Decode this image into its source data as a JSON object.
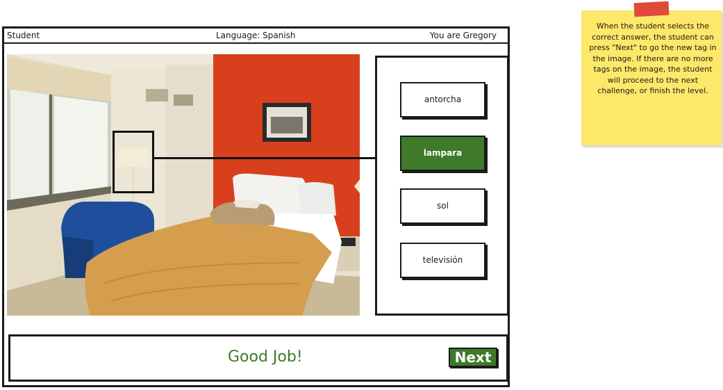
{
  "header": {
    "role": "Student",
    "language": "Language: Spanish",
    "user": "You are Gregory"
  },
  "options": [
    {
      "label": "antorcha",
      "selected": false
    },
    {
      "label": "lampara",
      "selected": true
    },
    {
      "label": "sol",
      "selected": false
    },
    {
      "label": "televisión",
      "selected": false
    }
  ],
  "feedback": {
    "message": "Good Job!",
    "next_label": "Next"
  },
  "note": {
    "text": "When the student selects the correct answer, the student can press \"Next\" to go the new tag in the image. If there are no more tags on the image, the student will proceed to the next challenge, or finish the level."
  },
  "colors": {
    "accent": "#3e7a29",
    "sticky": "#fde86a",
    "tape": "#e04a3a"
  }
}
